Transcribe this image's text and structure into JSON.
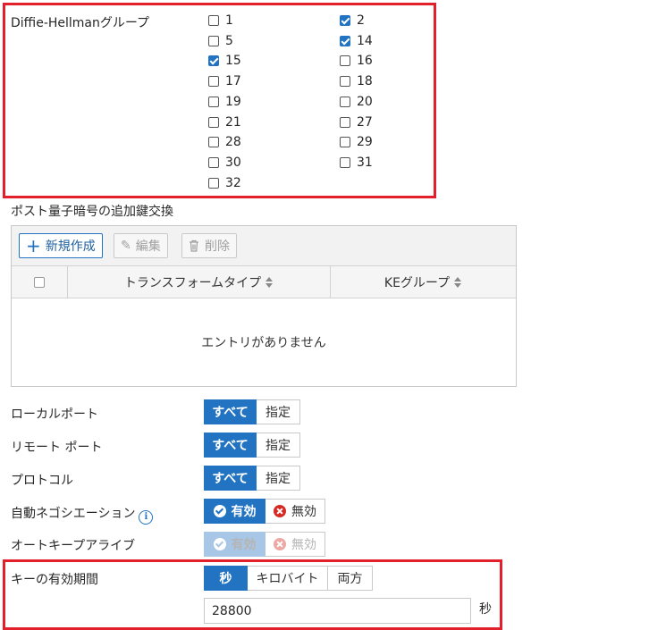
{
  "dh": {
    "label": "Diffie-Hellmanグループ",
    "groups": [
      {
        "n": "1",
        "checked": false
      },
      {
        "n": "2",
        "checked": true
      },
      {
        "n": "5",
        "checked": false
      },
      {
        "n": "14",
        "checked": true
      },
      {
        "n": "15",
        "checked": true
      },
      {
        "n": "16",
        "checked": false
      },
      {
        "n": "17",
        "checked": false
      },
      {
        "n": "18",
        "checked": false
      },
      {
        "n": "19",
        "checked": false
      },
      {
        "n": "20",
        "checked": false
      },
      {
        "n": "21",
        "checked": false
      },
      {
        "n": "27",
        "checked": false
      },
      {
        "n": "28",
        "checked": false
      },
      {
        "n": "29",
        "checked": false
      },
      {
        "n": "30",
        "checked": false
      },
      {
        "n": "31",
        "checked": false
      },
      {
        "n": "32",
        "checked": false
      }
    ]
  },
  "pq": {
    "title": "ポスト量子暗号の追加鍵交換",
    "toolbar": {
      "new_label": "新規作成",
      "edit_label": "編集",
      "delete_label": "削除"
    },
    "columns": {
      "transform": "トランスフォームタイプ",
      "ke": "KEグループ"
    },
    "empty": "エントリがありません"
  },
  "fields": {
    "local_port": {
      "label": "ローカルポート",
      "options": [
        "すべて",
        "指定"
      ],
      "selected": "すべて"
    },
    "remote_port": {
      "label": "リモート ポート",
      "options": [
        "すべて",
        "指定"
      ],
      "selected": "すべて"
    },
    "protocol": {
      "label": "プロトコル",
      "options": [
        "すべて",
        "指定"
      ],
      "selected": "すべて"
    },
    "auto_nego": {
      "label": "自動ネゴシエーション",
      "options": [
        "有効",
        "無効"
      ],
      "selected": "有効"
    },
    "autokey": {
      "label": "オートキープアライブ",
      "options": [
        "有効",
        "無効"
      ],
      "selected": "有効",
      "disabled": true
    },
    "key_life": {
      "label": "キーの有効期間",
      "options": [
        "秒",
        "キロバイト",
        "両方"
      ],
      "selected": "秒",
      "value": "28800",
      "unit": "秒"
    }
  },
  "colors": {
    "accent": "#2273c2",
    "highlight": "#e2202b",
    "danger": "#d42b25"
  }
}
